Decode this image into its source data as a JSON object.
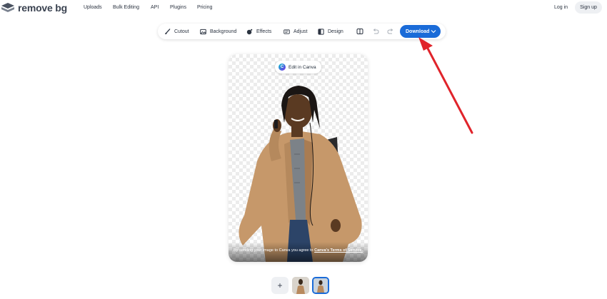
{
  "brand": {
    "name": "remove bg"
  },
  "nav": {
    "links": [
      "Uploads",
      "Bulk Editing",
      "API",
      "Plugins",
      "Pricing"
    ],
    "login": "Log in",
    "signup": "Sign up"
  },
  "toolbar": {
    "tools": [
      {
        "label": "Cutout",
        "icon": "brush-icon"
      },
      {
        "label": "Background",
        "icon": "image-icon"
      },
      {
        "label": "Effects",
        "icon": "effects-icon"
      },
      {
        "label": "Adjust",
        "icon": "adjust-icon"
      },
      {
        "label": "Design",
        "icon": "design-icon"
      }
    ],
    "download_label": "Download"
  },
  "editor": {
    "canva_label": "Edit in Canva",
    "terms_text": "By sending your image to Canva you agree to ",
    "terms_link": "Canva's Terms of Service."
  },
  "thumbnails": {
    "add_label": "+"
  },
  "colors": {
    "accent": "#1a6bd8",
    "arrow": "#e0242b"
  }
}
